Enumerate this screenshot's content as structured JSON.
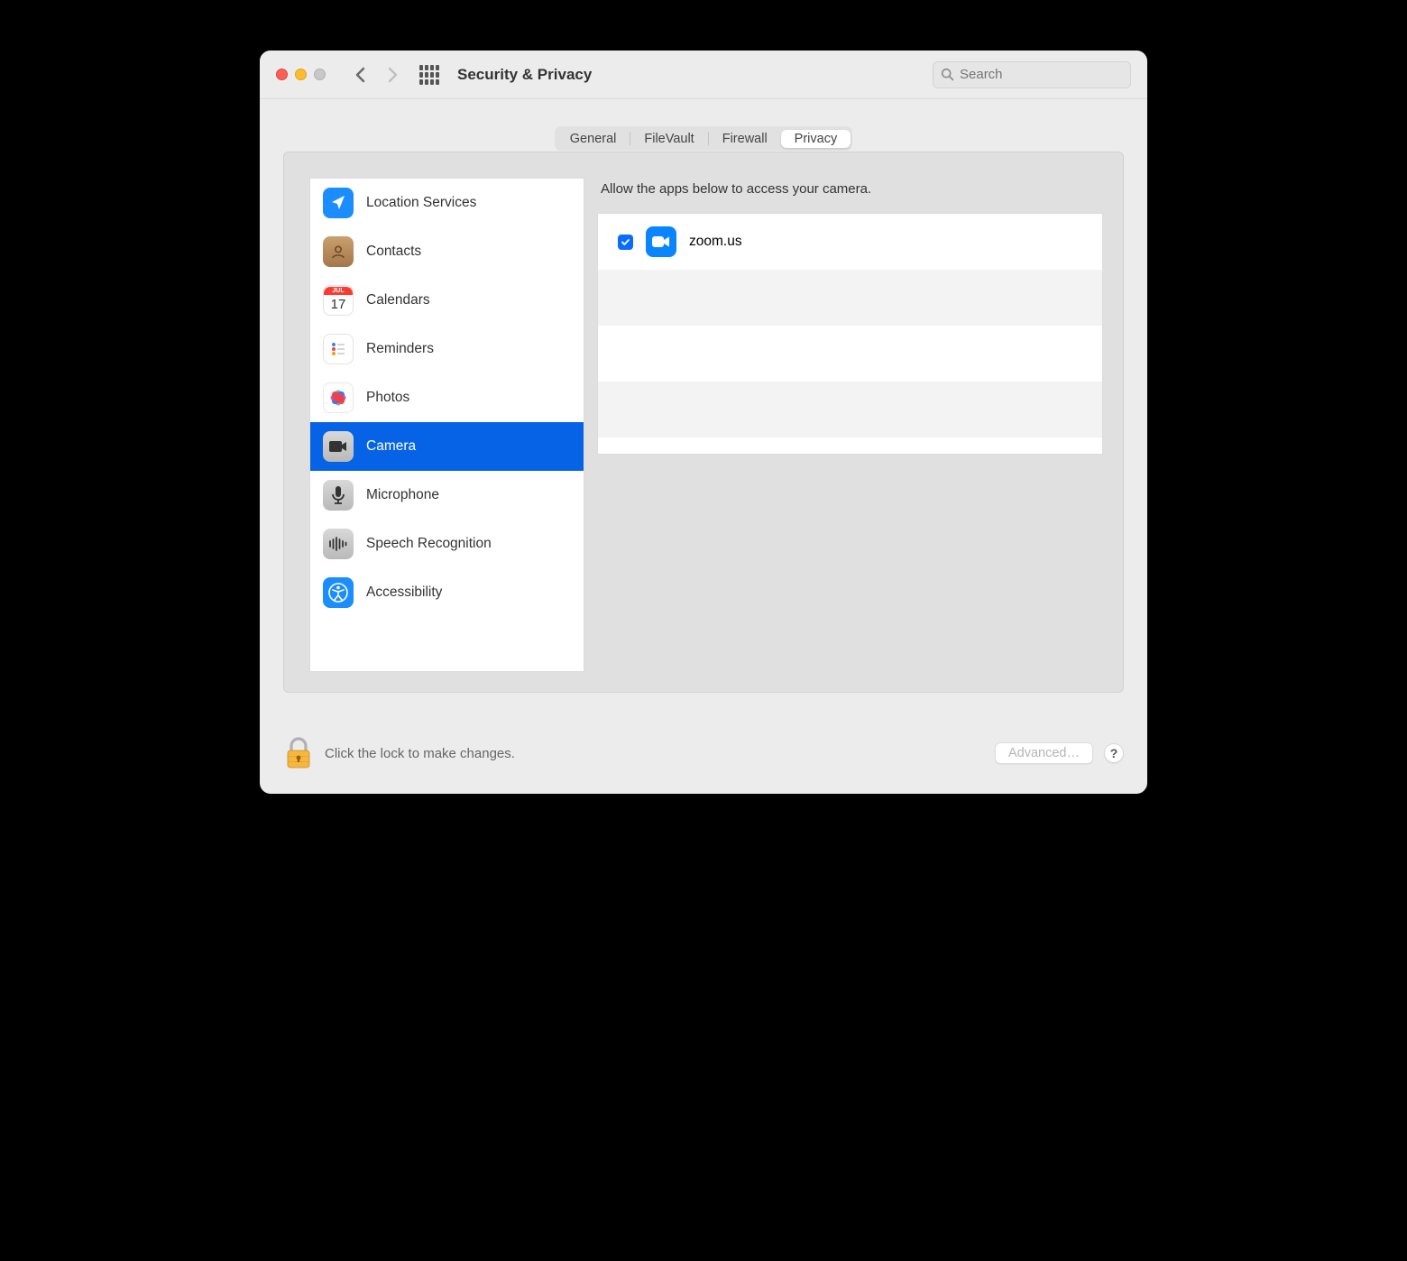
{
  "window": {
    "title": "Security & Privacy"
  },
  "search": {
    "placeholder": "Search"
  },
  "tabs": {
    "items": [
      "General",
      "FileVault",
      "Firewall",
      "Privacy"
    ],
    "active_index": 3
  },
  "sidebar": {
    "items": [
      {
        "label": "Location Services",
        "icon": "location"
      },
      {
        "label": "Contacts",
        "icon": "contacts"
      },
      {
        "label": "Calendars",
        "icon": "calendar",
        "badge": "JUL",
        "day": "17"
      },
      {
        "label": "Reminders",
        "icon": "reminders"
      },
      {
        "label": "Photos",
        "icon": "photos"
      },
      {
        "label": "Camera",
        "icon": "camera"
      },
      {
        "label": "Microphone",
        "icon": "microphone"
      },
      {
        "label": "Speech Recognition",
        "icon": "speech"
      },
      {
        "label": "Accessibility",
        "icon": "accessibility"
      }
    ],
    "selected_index": 5
  },
  "main": {
    "description": "Allow the apps below to access your camera.",
    "apps": [
      {
        "name": "zoom.us",
        "checked": true,
        "icon": "zoom"
      }
    ]
  },
  "footer": {
    "lock_text": "Click the lock to make changes.",
    "advanced_label": "Advanced…",
    "help_label": "?"
  }
}
